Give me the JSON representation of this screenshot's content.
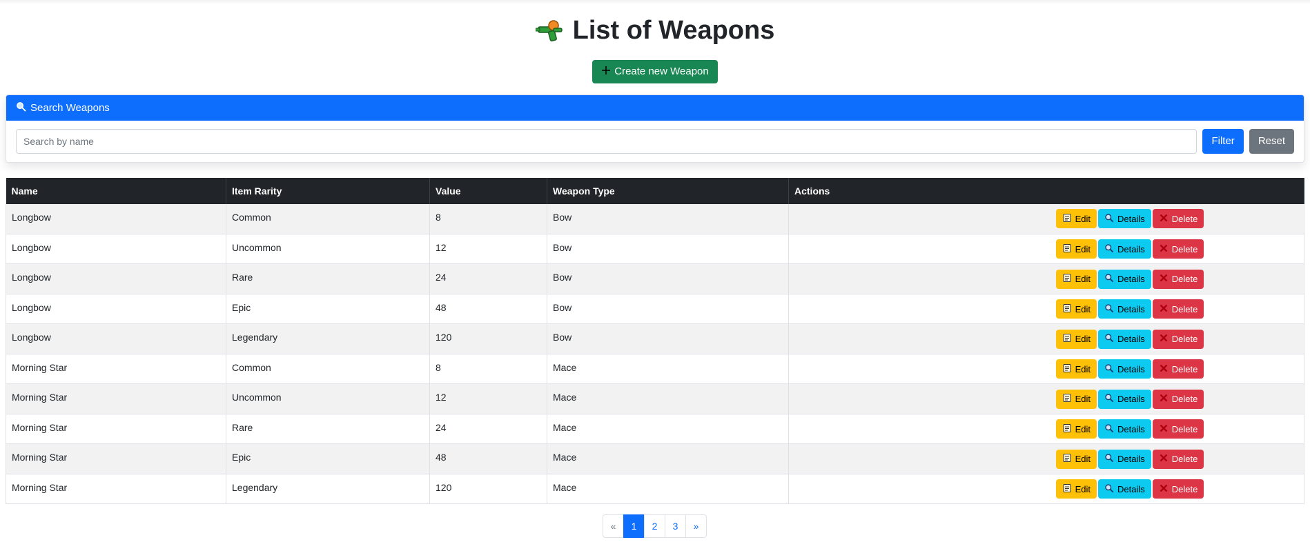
{
  "header": {
    "title": "List of Weapons",
    "create_label": "Create new Weapon"
  },
  "search": {
    "header": "Search Weapons",
    "placeholder": "Search by name",
    "filter_label": "Filter",
    "reset_label": "Reset"
  },
  "table": {
    "columns": [
      "Name",
      "Item Rarity",
      "Value",
      "Weapon Type",
      "Actions"
    ],
    "rows": [
      [
        "Longbow",
        "Common",
        "8",
        "Bow"
      ],
      [
        "Longbow",
        "Uncommon",
        "12",
        "Bow"
      ],
      [
        "Longbow",
        "Rare",
        "24",
        "Bow"
      ],
      [
        "Longbow",
        "Epic",
        "48",
        "Bow"
      ],
      [
        "Longbow",
        "Legendary",
        "120",
        "Bow"
      ],
      [
        "Morning Star",
        "Common",
        "8",
        "Mace"
      ],
      [
        "Morning Star",
        "Uncommon",
        "12",
        "Mace"
      ],
      [
        "Morning Star",
        "Rare",
        "24",
        "Mace"
      ],
      [
        "Morning Star",
        "Epic",
        "48",
        "Mace"
      ],
      [
        "Morning Star",
        "Legendary",
        "120",
        "Mace"
      ]
    ],
    "actions": {
      "edit": "Edit",
      "details": "Details",
      "delete": "Delete"
    }
  },
  "pagination": {
    "prev": "«",
    "pages": [
      "1",
      "2",
      "3"
    ],
    "next": "»",
    "current": "1"
  },
  "colors": {
    "primary": "#0d6efd",
    "success": "#198754",
    "warning": "#ffc107",
    "info": "#0dcaf0",
    "danger": "#dc3545",
    "secondary": "#6c757d",
    "dark": "#212529"
  },
  "icons": {
    "title": "water-gun-icon",
    "create": "plus-icon",
    "search": "magnifier-icon",
    "edit": "memo-icon",
    "details": "magnifier-icon",
    "delete": "cross-mark-icon"
  }
}
